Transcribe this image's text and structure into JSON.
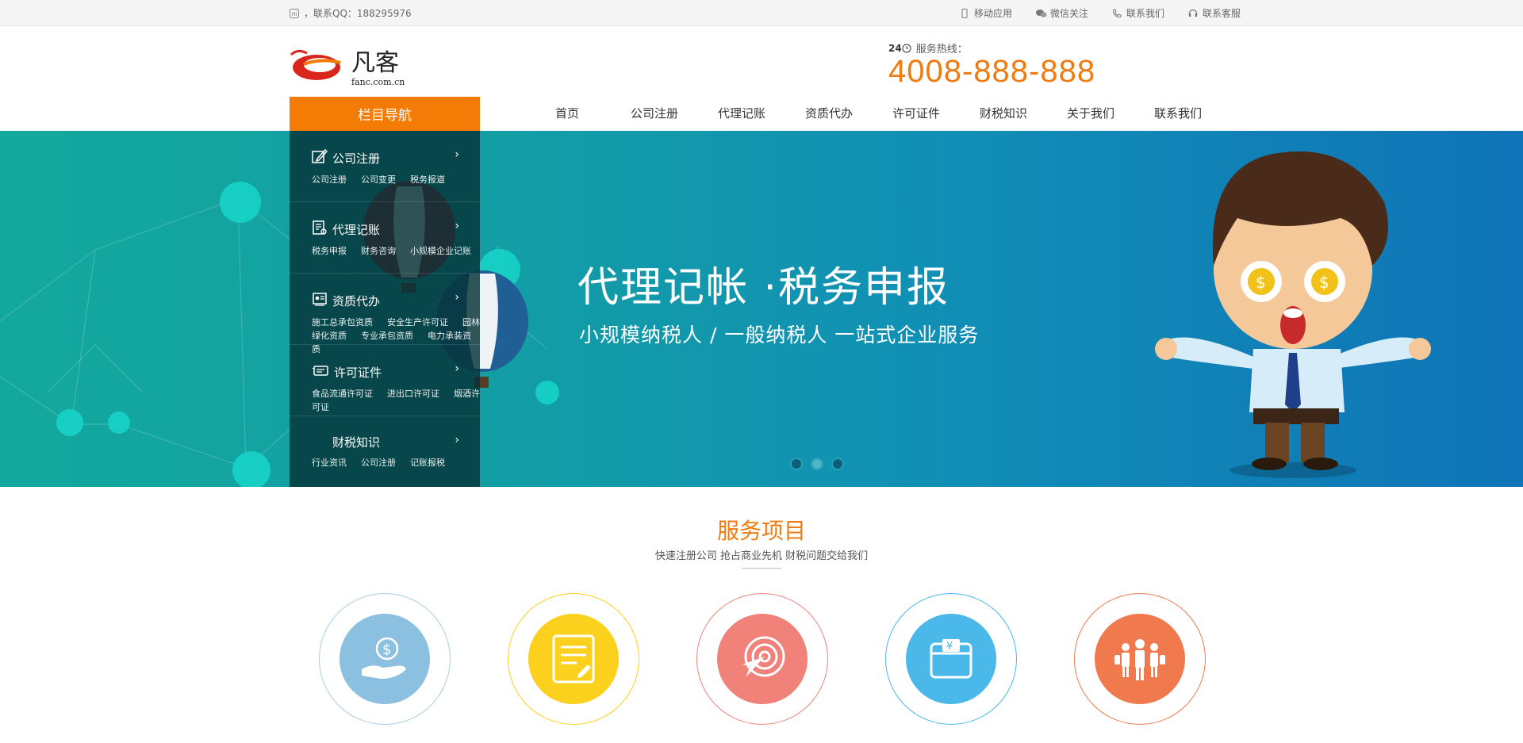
{
  "topbar": {
    "contact_text": "，联系QQ：188295976",
    "links": [
      {
        "label": "移动应用",
        "icon": "mobile-icon"
      },
      {
        "label": "微信关注",
        "icon": "wechat-icon"
      },
      {
        "label": "联系我们",
        "icon": "phone-icon"
      },
      {
        "label": "联系客服",
        "icon": "headset-icon"
      }
    ]
  },
  "header": {
    "logo_text": "凡客",
    "logo_sub": "fanc.com.cn",
    "hotline_label": "服务热线：",
    "hotline_badge": "24",
    "hotline_number": "4008-888-888"
  },
  "nav": {
    "category_title": "栏目导航",
    "items": [
      "首页",
      "公司注册",
      "代理记账",
      "资质代办",
      "许可证件",
      "财税知识",
      "关于我们",
      "联系我们"
    ]
  },
  "categories": [
    {
      "title": "公司注册",
      "subs": [
        "公司注册",
        "公司变更",
        "税务报道"
      ]
    },
    {
      "title": "代理记账",
      "subs": [
        "税务申报",
        "财务咨询",
        "小规模企业记账"
      ]
    },
    {
      "title": "资质代办",
      "subs": [
        "施工总承包资质",
        "安全生产许可证",
        "园林绿化资质",
        "专业承包资质",
        "电力承装资质"
      ]
    },
    {
      "title": "许可证件",
      "subs": [
        "食品流通许可证",
        "进出口许可证",
        "烟酒许可证"
      ]
    },
    {
      "title": "财税知识",
      "subs": [
        "行业资讯",
        "公司注册",
        "记账报税"
      ]
    }
  ],
  "banner": {
    "headline": "代理记帐 ·税务申报",
    "subline": "小规模纳税人 / 一般纳税人  一站式企业服务",
    "slide_count": 3,
    "active_slide": 2
  },
  "services": {
    "title": "服务项目",
    "subtitle": "快速注册公司 抢占商业先机 财税问题交给我们",
    "items": [
      {
        "icon": "money-hand-icon",
        "color": "#8cc0e0",
        "ring": "#a9cde6"
      },
      {
        "icon": "document-icon",
        "color": "#fbd11d",
        "ring": "#fbd11d"
      },
      {
        "icon": "target-icon",
        "color": "#f0827a",
        "ring": "#f0827a"
      },
      {
        "icon": "wallet-icon",
        "color": "#4ab8e8",
        "ring": "#4ab8e8"
      },
      {
        "icon": "team-icon",
        "color": "#f07a4e",
        "ring": "#f07a4e"
      }
    ]
  },
  "colors": {
    "accent": "#f47b05",
    "brand_red": "#d9261c"
  }
}
